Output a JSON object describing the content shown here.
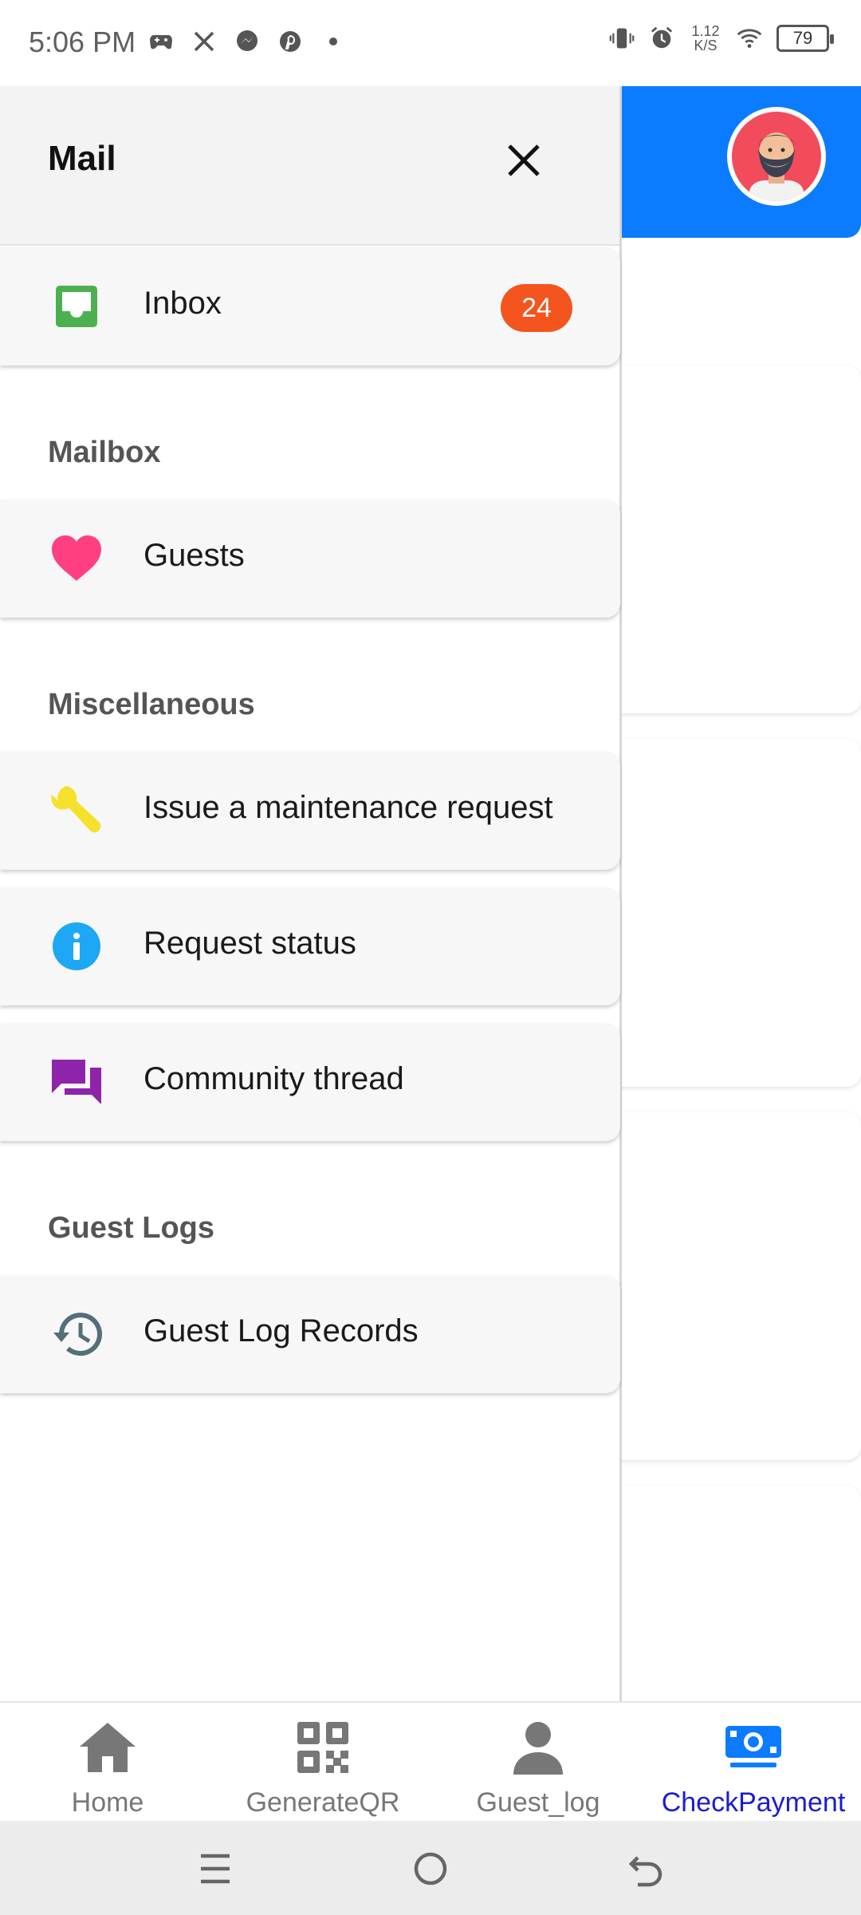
{
  "status_bar": {
    "time": "5:06 PM",
    "speed_top": "1.12",
    "speed_bottom": "K/S",
    "battery": "79"
  },
  "drawer": {
    "title": "Mail",
    "inbox": {
      "label": "Inbox",
      "badge": "24"
    },
    "sections": {
      "mailbox": "Mailbox",
      "misc": "Miscellaneous",
      "guest_logs": "Guest Logs"
    },
    "items": {
      "guests": "Guests",
      "maintenance": "Issue a maintenance request",
      "request_status": "Request status",
      "community": "Community thread",
      "guest_log_records": "Guest Log Records"
    }
  },
  "bottom_nav": {
    "home": "Home",
    "generate_qr": "GenerateQR",
    "guest_log": "Guest_log",
    "check_payment": "CheckPayment"
  },
  "colors": {
    "accent_blue": "#0b7bff",
    "badge": "#f4541d",
    "inbox_icon": "#4caf50",
    "heart": "#ff3f7f",
    "wrench": "#f5e12b",
    "info": "#1ea7f5",
    "forum": "#8e24aa",
    "active_nav": "#1b1bd6"
  }
}
